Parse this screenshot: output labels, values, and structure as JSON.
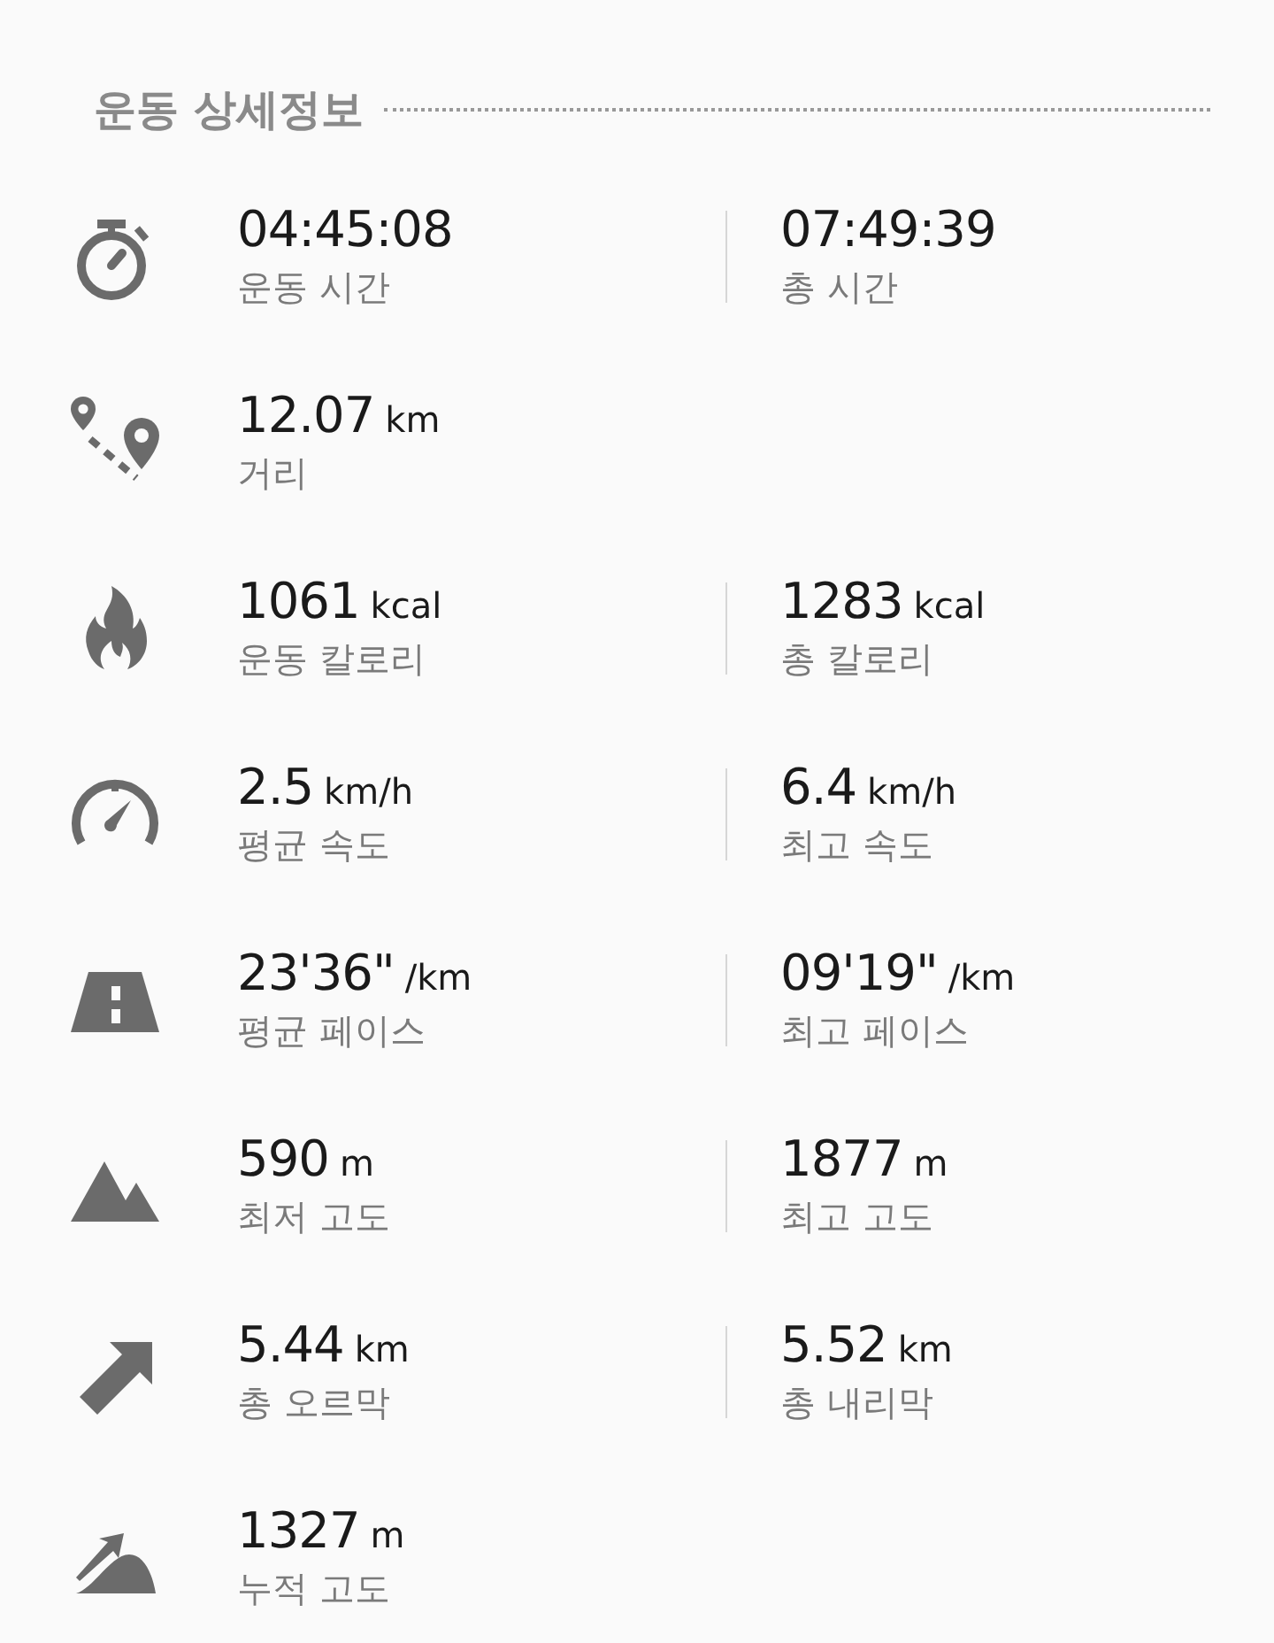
{
  "title": "운동 상세정보",
  "rows": [
    {
      "kind": "stopwatch",
      "stats": [
        {
          "value": "04:45:08",
          "label": "운동 시간"
        },
        {
          "value": "07:49:39",
          "label": "총 시간"
        }
      ]
    },
    {
      "kind": "route",
      "stats": [
        {
          "value": "12.07",
          "unit": "km",
          "label": "거리"
        }
      ]
    },
    {
      "kind": "flame",
      "stats": [
        {
          "value": "1061",
          "unit": "kcal",
          "label": "운동 칼로리"
        },
        {
          "value": "1283",
          "unit": "kcal",
          "label": "총 칼로리"
        }
      ]
    },
    {
      "kind": "gauge",
      "stats": [
        {
          "value": "2.5",
          "unit": "km/h",
          "label": "평균 속도"
        },
        {
          "value": "6.4",
          "unit": "km/h",
          "label": "최고 속도"
        }
      ]
    },
    {
      "kind": "road",
      "stats": [
        {
          "value": "23'36\"",
          "unit": "/km",
          "label": "평균 페이스"
        },
        {
          "value": "09'19\"",
          "unit": "/km",
          "label": "최고 페이스"
        }
      ]
    },
    {
      "kind": "mountain",
      "stats": [
        {
          "value": "590",
          "unit": "m",
          "label": "최저 고도"
        },
        {
          "value": "1877",
          "unit": "m",
          "label": "최고 고도"
        }
      ]
    },
    {
      "kind": "arrow",
      "stats": [
        {
          "value": "5.44",
          "unit": "km",
          "label": "총 오르막"
        },
        {
          "value": "5.52",
          "unit": "km",
          "label": "총 내리막"
        }
      ]
    },
    {
      "kind": "climb",
      "stats": [
        {
          "value": "1327",
          "unit": "m",
          "label": "누적 고도"
        }
      ]
    }
  ]
}
